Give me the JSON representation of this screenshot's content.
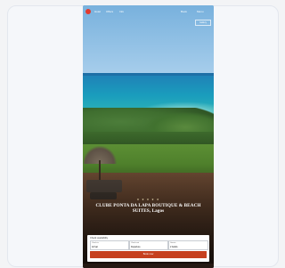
{
  "nav": {
    "links": [
      "Hotel",
      "Offers",
      "Info"
    ],
    "right_links": [
      "Book",
      "Menu"
    ],
    "gallery": "Gallery"
  },
  "hero": {
    "stars": "★ ★ ★ ★ ★",
    "title": "CLUBE PONTA DA LAPA BOUTIQUE & BEACH SUITES, Lagos"
  },
  "booking": {
    "title": "Check availability",
    "fields": [
      {
        "label": "Check-in",
        "value": "Arrival"
      },
      {
        "label": "Check-out",
        "value": "Departure"
      },
      {
        "label": "Guests",
        "value": "2 Adults"
      }
    ],
    "button": "Book now"
  }
}
